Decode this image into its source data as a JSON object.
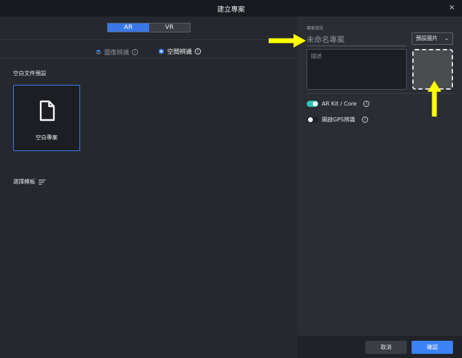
{
  "window": {
    "title": "建立專案",
    "close_glyph": "×"
  },
  "mode_toggle": {
    "options": [
      "AR",
      "VR"
    ],
    "active": "AR"
  },
  "tabs": [
    {
      "label": "圖像辨識",
      "active": false
    },
    {
      "label": "空間辨識",
      "active": true
    }
  ],
  "left": {
    "blank_section_label": "空白文件預設",
    "blank_card_label": "空白專案",
    "template_label": "選擇模板"
  },
  "right": {
    "info_header": "專案資訊",
    "name_input": {
      "value": "",
      "placeholder": "未命名專案"
    },
    "image_select": {
      "selected": "預設圖片"
    },
    "description": {
      "value": "",
      "placeholder": "描述"
    },
    "toggles": [
      {
        "label": "AR Kit / Core",
        "on": true
      },
      {
        "label": "開啟GPS辨識",
        "on": false
      }
    ]
  },
  "footer": {
    "cancel_label": "取消",
    "confirm_label": "確認"
  },
  "colors": {
    "accent_blue": "#3b82f6",
    "teal": "#2ec4b6",
    "arrow_yellow": "#ffff00",
    "panel_bg": "#25282e"
  },
  "icons": {
    "close": "close-icon",
    "image_tab": "image-recognition-icon",
    "space_tab": "space-recognition-icon",
    "document": "document-icon",
    "sort": "sort-lines-icon",
    "info": "info-icon",
    "chevron": "chevron-down-icon"
  }
}
